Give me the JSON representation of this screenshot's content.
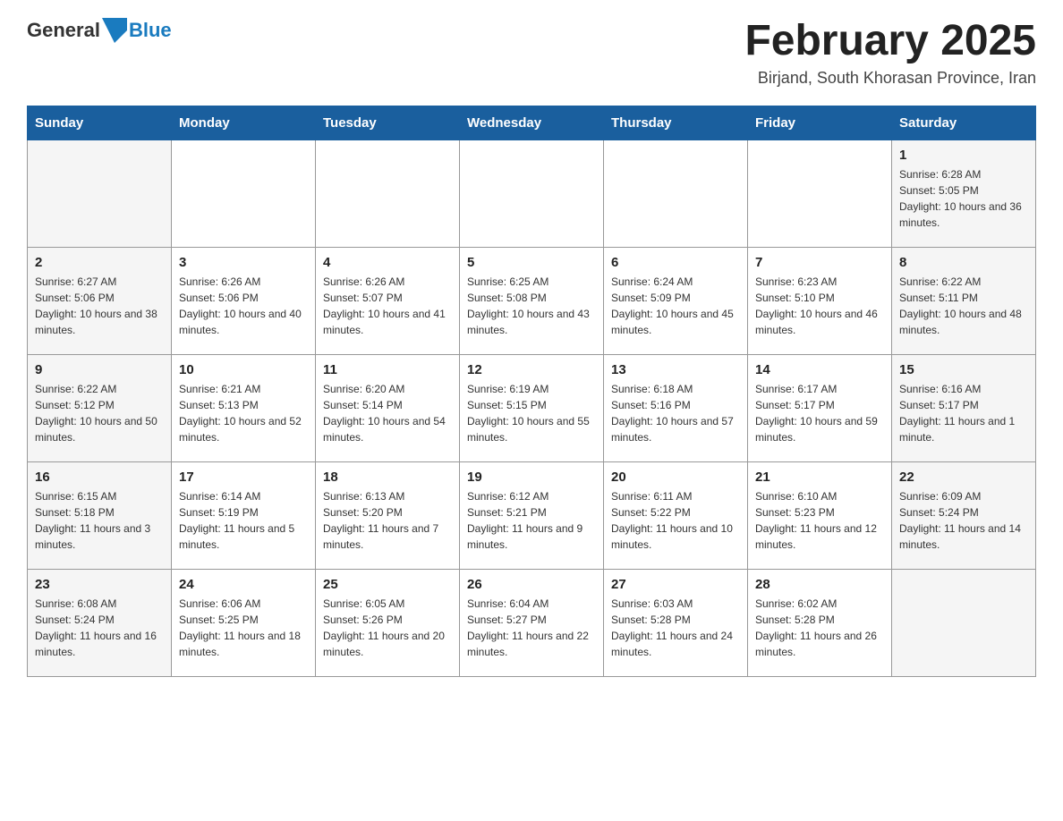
{
  "header": {
    "logo": {
      "general": "General",
      "blue": "Blue"
    },
    "title": "February 2025",
    "location": "Birjand, South Khorasan Province, Iran"
  },
  "days_of_week": [
    "Sunday",
    "Monday",
    "Tuesday",
    "Wednesday",
    "Thursday",
    "Friday",
    "Saturday"
  ],
  "weeks": [
    [
      {
        "day": "",
        "sunrise": "",
        "sunset": "",
        "daylight": ""
      },
      {
        "day": "",
        "sunrise": "",
        "sunset": "",
        "daylight": ""
      },
      {
        "day": "",
        "sunrise": "",
        "sunset": "",
        "daylight": ""
      },
      {
        "day": "",
        "sunrise": "",
        "sunset": "",
        "daylight": ""
      },
      {
        "day": "",
        "sunrise": "",
        "sunset": "",
        "daylight": ""
      },
      {
        "day": "",
        "sunrise": "",
        "sunset": "",
        "daylight": ""
      },
      {
        "day": "1",
        "sunrise": "Sunrise: 6:28 AM",
        "sunset": "Sunset: 5:05 PM",
        "daylight": "Daylight: 10 hours and 36 minutes."
      }
    ],
    [
      {
        "day": "2",
        "sunrise": "Sunrise: 6:27 AM",
        "sunset": "Sunset: 5:06 PM",
        "daylight": "Daylight: 10 hours and 38 minutes."
      },
      {
        "day": "3",
        "sunrise": "Sunrise: 6:26 AM",
        "sunset": "Sunset: 5:06 PM",
        "daylight": "Daylight: 10 hours and 40 minutes."
      },
      {
        "day": "4",
        "sunrise": "Sunrise: 6:26 AM",
        "sunset": "Sunset: 5:07 PM",
        "daylight": "Daylight: 10 hours and 41 minutes."
      },
      {
        "day": "5",
        "sunrise": "Sunrise: 6:25 AM",
        "sunset": "Sunset: 5:08 PM",
        "daylight": "Daylight: 10 hours and 43 minutes."
      },
      {
        "day": "6",
        "sunrise": "Sunrise: 6:24 AM",
        "sunset": "Sunset: 5:09 PM",
        "daylight": "Daylight: 10 hours and 45 minutes."
      },
      {
        "day": "7",
        "sunrise": "Sunrise: 6:23 AM",
        "sunset": "Sunset: 5:10 PM",
        "daylight": "Daylight: 10 hours and 46 minutes."
      },
      {
        "day": "8",
        "sunrise": "Sunrise: 6:22 AM",
        "sunset": "Sunset: 5:11 PM",
        "daylight": "Daylight: 10 hours and 48 minutes."
      }
    ],
    [
      {
        "day": "9",
        "sunrise": "Sunrise: 6:22 AM",
        "sunset": "Sunset: 5:12 PM",
        "daylight": "Daylight: 10 hours and 50 minutes."
      },
      {
        "day": "10",
        "sunrise": "Sunrise: 6:21 AM",
        "sunset": "Sunset: 5:13 PM",
        "daylight": "Daylight: 10 hours and 52 minutes."
      },
      {
        "day": "11",
        "sunrise": "Sunrise: 6:20 AM",
        "sunset": "Sunset: 5:14 PM",
        "daylight": "Daylight: 10 hours and 54 minutes."
      },
      {
        "day": "12",
        "sunrise": "Sunrise: 6:19 AM",
        "sunset": "Sunset: 5:15 PM",
        "daylight": "Daylight: 10 hours and 55 minutes."
      },
      {
        "day": "13",
        "sunrise": "Sunrise: 6:18 AM",
        "sunset": "Sunset: 5:16 PM",
        "daylight": "Daylight: 10 hours and 57 minutes."
      },
      {
        "day": "14",
        "sunrise": "Sunrise: 6:17 AM",
        "sunset": "Sunset: 5:17 PM",
        "daylight": "Daylight: 10 hours and 59 minutes."
      },
      {
        "day": "15",
        "sunrise": "Sunrise: 6:16 AM",
        "sunset": "Sunset: 5:17 PM",
        "daylight": "Daylight: 11 hours and 1 minute."
      }
    ],
    [
      {
        "day": "16",
        "sunrise": "Sunrise: 6:15 AM",
        "sunset": "Sunset: 5:18 PM",
        "daylight": "Daylight: 11 hours and 3 minutes."
      },
      {
        "day": "17",
        "sunrise": "Sunrise: 6:14 AM",
        "sunset": "Sunset: 5:19 PM",
        "daylight": "Daylight: 11 hours and 5 minutes."
      },
      {
        "day": "18",
        "sunrise": "Sunrise: 6:13 AM",
        "sunset": "Sunset: 5:20 PM",
        "daylight": "Daylight: 11 hours and 7 minutes."
      },
      {
        "day": "19",
        "sunrise": "Sunrise: 6:12 AM",
        "sunset": "Sunset: 5:21 PM",
        "daylight": "Daylight: 11 hours and 9 minutes."
      },
      {
        "day": "20",
        "sunrise": "Sunrise: 6:11 AM",
        "sunset": "Sunset: 5:22 PM",
        "daylight": "Daylight: 11 hours and 10 minutes."
      },
      {
        "day": "21",
        "sunrise": "Sunrise: 6:10 AM",
        "sunset": "Sunset: 5:23 PM",
        "daylight": "Daylight: 11 hours and 12 minutes."
      },
      {
        "day": "22",
        "sunrise": "Sunrise: 6:09 AM",
        "sunset": "Sunset: 5:24 PM",
        "daylight": "Daylight: 11 hours and 14 minutes."
      }
    ],
    [
      {
        "day": "23",
        "sunrise": "Sunrise: 6:08 AM",
        "sunset": "Sunset: 5:24 PM",
        "daylight": "Daylight: 11 hours and 16 minutes."
      },
      {
        "day": "24",
        "sunrise": "Sunrise: 6:06 AM",
        "sunset": "Sunset: 5:25 PM",
        "daylight": "Daylight: 11 hours and 18 minutes."
      },
      {
        "day": "25",
        "sunrise": "Sunrise: 6:05 AM",
        "sunset": "Sunset: 5:26 PM",
        "daylight": "Daylight: 11 hours and 20 minutes."
      },
      {
        "day": "26",
        "sunrise": "Sunrise: 6:04 AM",
        "sunset": "Sunset: 5:27 PM",
        "daylight": "Daylight: 11 hours and 22 minutes."
      },
      {
        "day": "27",
        "sunrise": "Sunrise: 6:03 AM",
        "sunset": "Sunset: 5:28 PM",
        "daylight": "Daylight: 11 hours and 24 minutes."
      },
      {
        "day": "28",
        "sunrise": "Sunrise: 6:02 AM",
        "sunset": "Sunset: 5:28 PM",
        "daylight": "Daylight: 11 hours and 26 minutes."
      },
      {
        "day": "",
        "sunrise": "",
        "sunset": "",
        "daylight": ""
      }
    ]
  ]
}
